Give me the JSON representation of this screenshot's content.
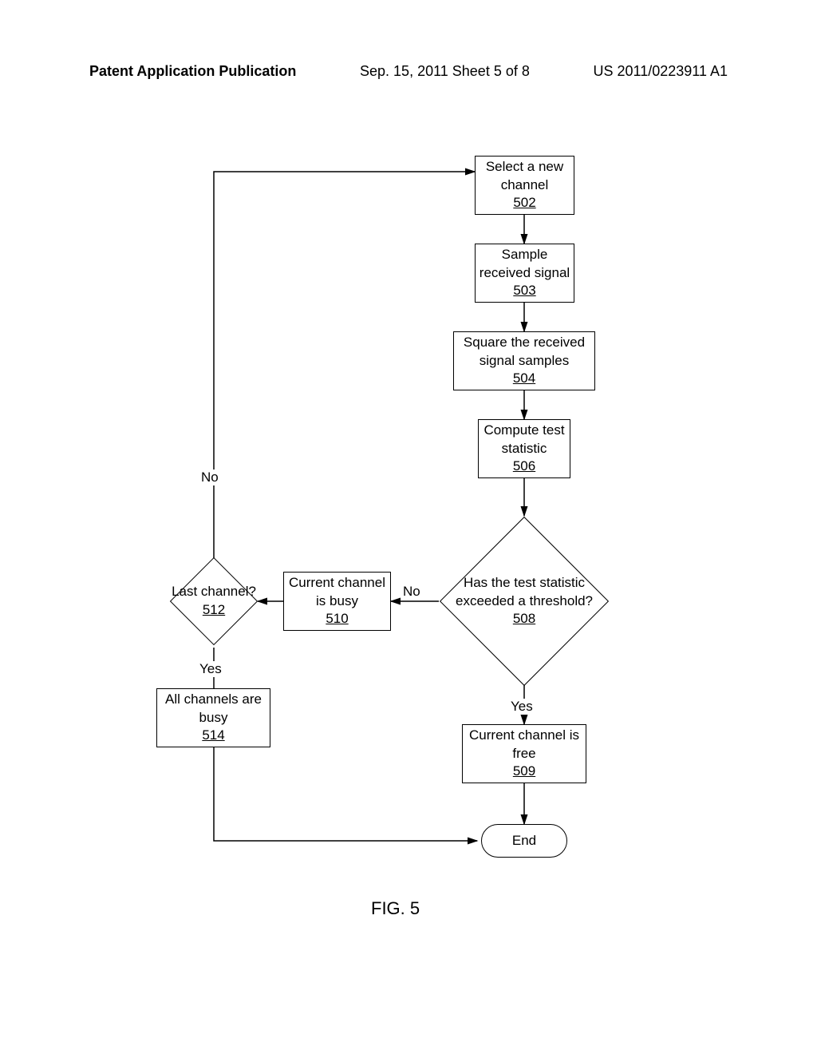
{
  "header": {
    "left": "Patent Application Publication",
    "center": "Sep. 15, 2011   Sheet 5 of 8",
    "right": "US 2011/0223911 A1"
  },
  "nodes": {
    "n502": {
      "text": "Select a new channel",
      "ref": "502"
    },
    "n503": {
      "text": "Sample received signal",
      "ref": "503"
    },
    "n504": {
      "text": "Square the received signal samples",
      "ref": "504"
    },
    "n506": {
      "text": "Compute test statistic",
      "ref": "506"
    },
    "n508": {
      "text": "Has the test statistic exceeded a threshold?",
      "ref": "508"
    },
    "n509": {
      "text": "Current channel is free",
      "ref": "509"
    },
    "n510": {
      "text": "Current channel is busy",
      "ref": "510"
    },
    "n512": {
      "text": "Last channel?",
      "ref": "512"
    },
    "n514": {
      "text": "All channels are busy",
      "ref": "514"
    },
    "end": {
      "text": "End"
    }
  },
  "labels": {
    "no_508": "No",
    "yes_508": "Yes",
    "no_512": "No",
    "yes_512": "Yes"
  },
  "figure": "FIG. 5"
}
